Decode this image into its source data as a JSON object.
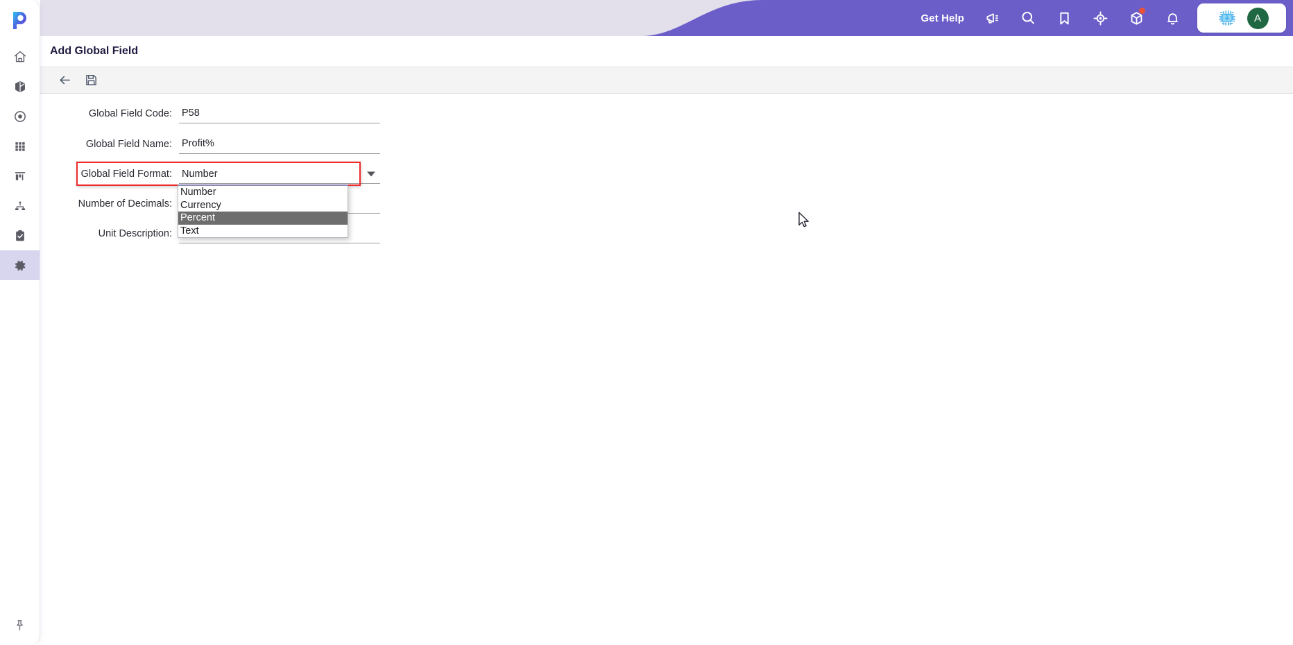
{
  "app": {
    "logo": "pims-logo",
    "accent_purple": "#6b5ec9",
    "topbar_bg": "#e3e0ec",
    "highlight_color": "#ee2b2b",
    "avatar_color": "#206843"
  },
  "rail": {
    "items": [
      {
        "name": "home",
        "icon": "home-icon",
        "active": false
      },
      {
        "name": "package",
        "icon": "cube-icon",
        "active": false
      },
      {
        "name": "target",
        "icon": "record-circle-icon",
        "active": false
      },
      {
        "name": "grid",
        "icon": "grid-icon",
        "active": false
      },
      {
        "name": "reports",
        "icon": "bar-chart-icon",
        "active": false
      },
      {
        "name": "hierarchy",
        "icon": "org-chart-icon",
        "active": false
      },
      {
        "name": "tasks",
        "icon": "clipboard-check-icon",
        "active": false
      },
      {
        "name": "settings",
        "icon": "gear-icon",
        "active": true
      }
    ],
    "pin": {
      "name": "pin",
      "icon": "pushpin-icon"
    }
  },
  "topbar": {
    "get_help_label": "Get Help",
    "icons": [
      {
        "name": "announcements",
        "icon": "megaphone-icon",
        "badge": false
      },
      {
        "name": "search",
        "icon": "search-icon",
        "badge": false
      },
      {
        "name": "bookmarks",
        "icon": "bookmark-icon",
        "badge": false
      },
      {
        "name": "locate",
        "icon": "crosshair-icon",
        "badge": false
      },
      {
        "name": "modules",
        "icon": "box-3d-icon",
        "badge": true
      },
      {
        "name": "notifications",
        "icon": "bell-icon",
        "badge": false
      }
    ],
    "user": {
      "chip_icon": "microchip-icon",
      "avatar_initial": "A"
    }
  },
  "page": {
    "title": "Add Global Field"
  },
  "toolbar": {
    "buttons": [
      {
        "name": "back",
        "icon": "arrow-left-icon",
        "label": "Back"
      },
      {
        "name": "save",
        "icon": "floppy-disk-icon",
        "label": "Save"
      }
    ]
  },
  "form": {
    "fields": [
      {
        "key": "code",
        "label": "Global Field Code:",
        "value": "P58",
        "placeholder": "",
        "type": "text"
      },
      {
        "key": "name",
        "label": "Global Field Name:",
        "value": "Profit%",
        "placeholder": "",
        "type": "text"
      },
      {
        "key": "format",
        "label": "Global Field Format:",
        "value": "Number",
        "placeholder": "",
        "type": "select"
      },
      {
        "key": "decimals",
        "label": "Number of Decimals:",
        "value": "",
        "placeholder": "",
        "type": "text"
      },
      {
        "key": "unit",
        "label": "Unit Description:",
        "value": "",
        "placeholder": "",
        "type": "text"
      }
    ],
    "format_options": [
      {
        "label": "Number",
        "selected": false
      },
      {
        "label": "Currency",
        "selected": false
      },
      {
        "label": "Percent",
        "selected": true
      },
      {
        "label": "Text",
        "selected": false
      }
    ]
  }
}
